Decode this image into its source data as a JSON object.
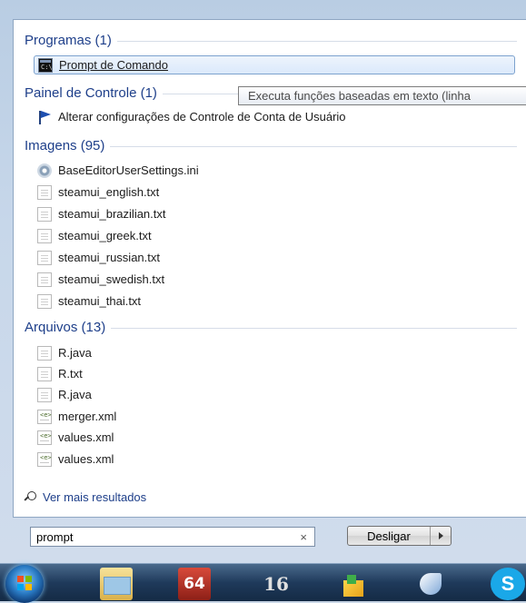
{
  "groups": {
    "programs": {
      "header": "Programas (1)",
      "items": [
        {
          "label": "Prompt de Comando",
          "icon": "cmd-icon"
        }
      ]
    },
    "control_panel": {
      "header": "Painel de Controle (1)",
      "items": [
        {
          "label": "Alterar configurações de Controle de Conta de Usuário",
          "icon": "uac-flag-icon"
        }
      ]
    },
    "images": {
      "header": "Imagens (95)",
      "items": [
        {
          "label": "BaseEditorUserSettings.ini",
          "icon": "settings-file-icon"
        },
        {
          "label": "steamui_english.txt",
          "icon": "text-file-icon"
        },
        {
          "label": "steamui_brazilian.txt",
          "icon": "text-file-icon"
        },
        {
          "label": "steamui_greek.txt",
          "icon": "text-file-icon"
        },
        {
          "label": "steamui_russian.txt",
          "icon": "text-file-icon"
        },
        {
          "label": "steamui_swedish.txt",
          "icon": "text-file-icon"
        },
        {
          "label": "steamui_thai.txt",
          "icon": "text-file-icon"
        }
      ]
    },
    "files": {
      "header": "Arquivos (13)",
      "items": [
        {
          "label": "R.java",
          "icon": "text-file-icon"
        },
        {
          "label": "R.txt",
          "icon": "text-file-icon"
        },
        {
          "label": "R.java",
          "icon": "text-file-icon"
        },
        {
          "label": "merger.xml",
          "icon": "xml-file-icon"
        },
        {
          "label": "values.xml",
          "icon": "xml-file-icon"
        },
        {
          "label": "values.xml",
          "icon": "xml-file-icon"
        }
      ]
    }
  },
  "tooltip": "Executa funções baseadas em texto (linha",
  "see_more": "Ver mais resultados",
  "search": {
    "value": "prompt",
    "clear": "×"
  },
  "shutdown": {
    "label": "Desligar"
  },
  "taskbar": {
    "icon_64": "64",
    "icon_16": "16",
    "icon_skype": "S"
  }
}
